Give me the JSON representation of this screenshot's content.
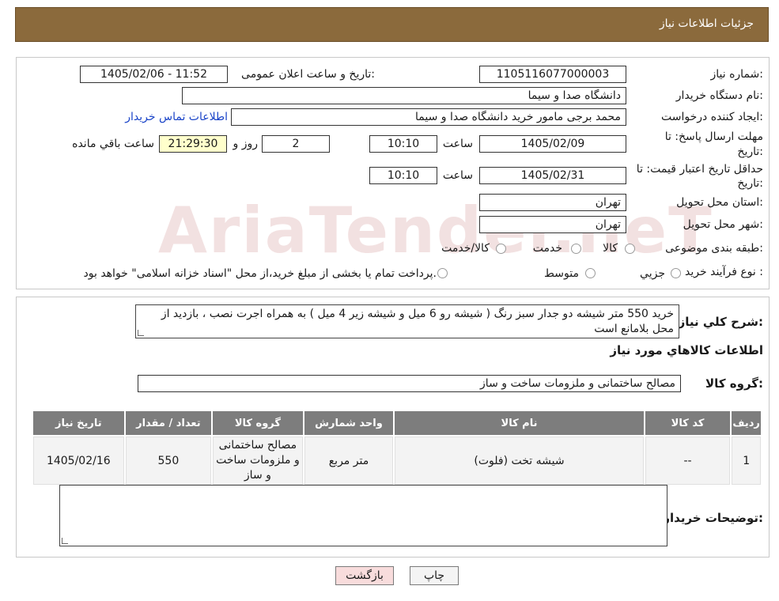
{
  "header": {
    "title": "جزئیات اطلاعات نیاز"
  },
  "watermark": {
    "text": "AriaTender.neT"
  },
  "form": {
    "need_number_label": "شماره نیاز:",
    "need_number": "1105116077000003",
    "announce_label": "تاریخ و ساعت اعلان عمومی:",
    "announce_value": "1405/02/06 - 11:52",
    "buyer_org_label": "نام دستگاه خریدار:",
    "buyer_org": "دانشگاه صدا و سیما",
    "requester_label": "ایجاد کننده درخواست:",
    "requester": "محمد برجی مامور خرید دانشگاه صدا و سیما",
    "contact_link": "اطلاعات تماس خریدار",
    "deadline_label_1": "مهلت ارسال پاسخ: تا",
    "deadline_label_2": "تاریخ:",
    "deadline_date": "1405/02/09",
    "time_label": "ساعت",
    "deadline_time": "10:10",
    "days_value": "2",
    "days_label": "روز و",
    "remaining_time": "21:29:30",
    "remaining_label": "ساعت باقي مانده",
    "validity_label_1": "حداقل تاریخ اعتبار قیمت: تا",
    "validity_label_2": "تاریخ:",
    "validity_date": "1405/02/31",
    "validity_time": "10:10",
    "province_label": "استان محل تحویل:",
    "province": "تهران",
    "city_label": "شهر محل تحویل:",
    "city": "تهران",
    "category_label": "طبقه بندی موضوعی:",
    "category_options": [
      "کالا",
      "خدمت",
      "کالا/خدمت"
    ],
    "process_label": "نوع فرآیند خرید :",
    "process_options": [
      "جزيي",
      "متوسط"
    ],
    "process_note": "پرداخت تمام یا بخشی از مبلغ خرید،از محل \"اسناد خزانه اسلامی\" خواهد بود."
  },
  "description": {
    "label": "شرح كلي نياز:",
    "text": "خرید 550 متر شیشه دو جدار سبز رنگ ( شیشه رو 6 میل و شیشه زیر 4 میل ) به همراه اجرت نصب ، بازدید از محل بلامانع است",
    "goods_info_title": "اطلاعات كالاهاي مورد نياز",
    "goods_group_label": "گروه کالا:",
    "goods_group": "مصالح ساختمانی و ملزومات ساخت و ساز"
  },
  "table": {
    "headers": [
      "رديف",
      "کد کالا",
      "نام کالا",
      "واحد شمارش",
      "گروه کالا",
      "تعداد / مقدار",
      "تاریخ نیاز"
    ],
    "rows": [
      [
        "1",
        "--",
        "شیشه تخت (فلوت)",
        "متر مربع",
        "مصالح ساختمانی و ملزومات ساخت و ساز",
        "550",
        "1405/02/16"
      ]
    ]
  },
  "buyer_notes": {
    "label": "توضیحات خریدار:",
    "text": ""
  },
  "buttons": {
    "print": "چاپ",
    "back": "بازگشت"
  }
}
